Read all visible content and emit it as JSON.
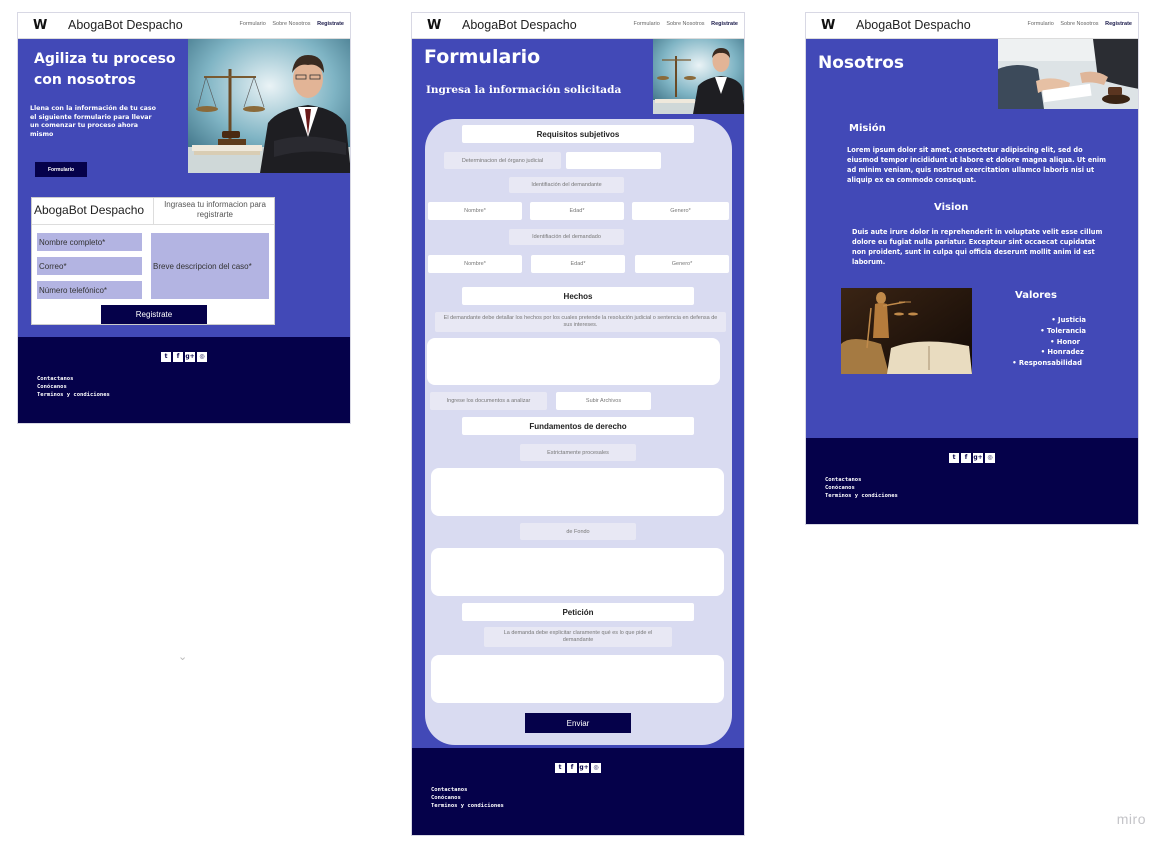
{
  "brand": "AbogaBot Despacho",
  "logo": "W",
  "nav": {
    "link1": "Formulario",
    "link2": "Sobre Nosotros",
    "link3": "Registrate"
  },
  "footer": {
    "links": [
      "Contactanos",
      "Conócanos",
      "Terminos y condiciones"
    ],
    "social_icons": [
      "twitter-icon",
      "facebook-icon",
      "google-plus-icon",
      "instagram-icon"
    ]
  },
  "home": {
    "hero_title_line1": "Agiliza tu proceso",
    "hero_title_line2": "con nosotros",
    "hero_text": "Llena con la información de tu caso el siguiente formulario para llevar un comenzar tu proceso ahora mismo",
    "hero_button": "Formulario",
    "register_brand": "AbogaBot Despacho",
    "register_hint": "Ingrasea tu informacion para registrarte",
    "name_placeholder": "Nombre completo*",
    "email_placeholder": "Correo*",
    "phone_placeholder": "Número telefónico*",
    "case_placeholder": "Breve descripcion del caso*",
    "register_button": "Registrate"
  },
  "form": {
    "title": "Formulario",
    "subtitle": "Ingresa la información solicitada",
    "subjective": "Requisitos subjetivos",
    "judicial": "Determinacion del órgano judicial",
    "plaintiff_id": "Identifiación del demandante",
    "name": "Nombre*",
    "age": "Edad*",
    "gender": "Genero*",
    "defendant_id": "Identifiación del demandado",
    "facts": "Hechos",
    "facts_desc": "El demandante debe detallar los hechos por los cuales pretende la resolución judicial o sentencia en defensa de sus intereses.",
    "docs_label": "Ingrese los documentos a analizar",
    "upload_button": "Subir Archivos",
    "law": "Fundamentos de derecho",
    "procedural": "Estrictamente procesales",
    "substantive": "de Fondo",
    "petition": "Petición",
    "petition_desc": "La demanda debe explicitar claramente qué es lo que pide el demandante",
    "submit": "Enviar"
  },
  "about": {
    "title": "Nosotros",
    "mission_title": "Misión",
    "mission_text": "Lorem ipsum dolor sit amet, consectetur adipiscing elit, sed do eiusmod tempor incididunt ut labore et dolore magna aliqua. Ut enim ad minim veniam, quis nostrud exercitation ullamco laboris nisi ut aliquip ex ea commodo consequat.",
    "vision_title": "Vision",
    "vision_text": "Duis aute irure dolor in reprehenderit in voluptate velit esse cillum dolore eu fugiat nulla pariatur. Excepteur sint occaecat cupidatat non proident, sunt in culpa qui officia deserunt mollit anim id est laborum.",
    "values_title": "Valores",
    "values": [
      "Justicia",
      "Tolerancia",
      "Honor",
      "Honradez",
      "Responsabilidad"
    ]
  },
  "watermark": "miro",
  "colors": {
    "primary": "#4249b7",
    "dark": "#05014a",
    "lavender": "#b3b4e2",
    "form_bg": "#d9dbf1"
  }
}
